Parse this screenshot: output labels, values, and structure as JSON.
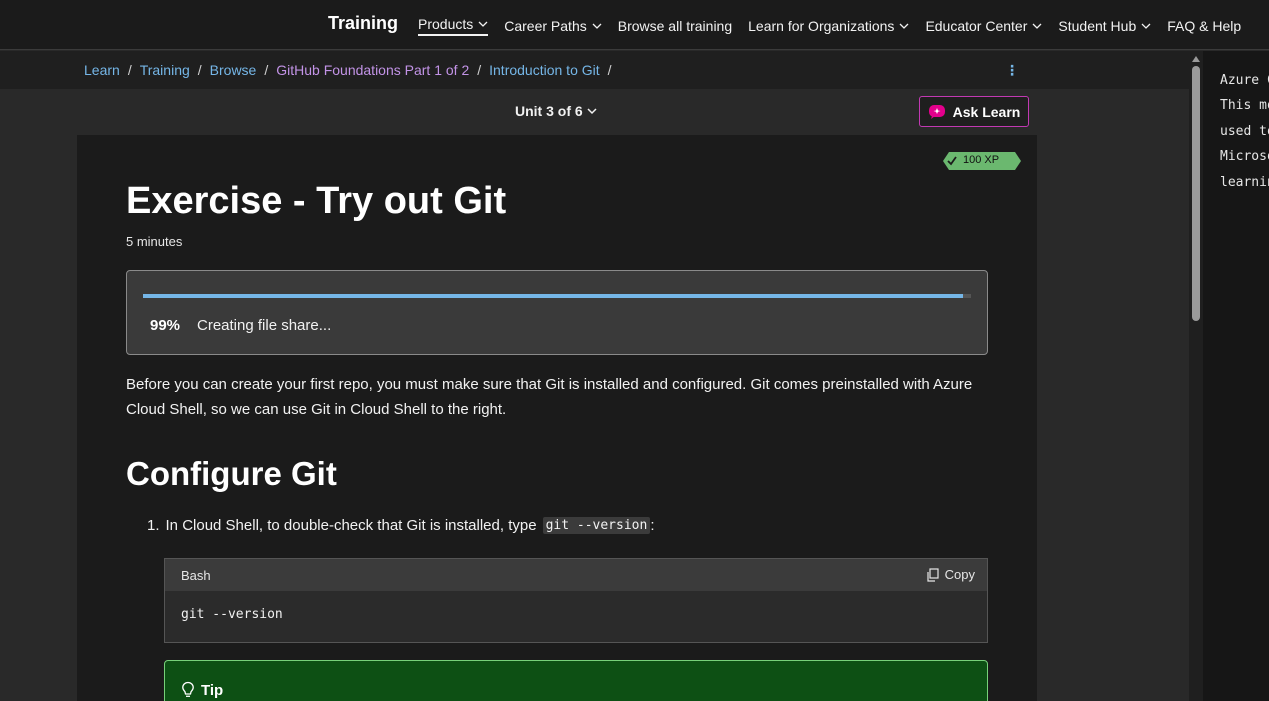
{
  "nav": {
    "brand": "Training",
    "items": [
      {
        "label": "Products",
        "dropdown": true,
        "active": true
      },
      {
        "label": "Career Paths",
        "dropdown": true
      },
      {
        "label": "Browse all training",
        "dropdown": false
      },
      {
        "label": "Learn for Organizations",
        "dropdown": true
      },
      {
        "label": "Educator Center",
        "dropdown": true
      },
      {
        "label": "Student Hub",
        "dropdown": true
      },
      {
        "label": "FAQ & Help",
        "dropdown": false
      }
    ]
  },
  "breadcrumb": [
    {
      "label": "Learn"
    },
    {
      "label": "Training"
    },
    {
      "label": "Browse"
    },
    {
      "label": "GitHub Foundations Part 1 of 2"
    },
    {
      "label": "Introduction to Git"
    }
  ],
  "unit": {
    "label": "Unit 3 of 6"
  },
  "ask_learn": {
    "label": "Ask Learn"
  },
  "xp": {
    "label": "100 XP"
  },
  "page": {
    "title": "Exercise - Try out Git",
    "duration": "5 minutes"
  },
  "progress": {
    "percent_label": "99%",
    "percent": 99,
    "status": "Creating file share..."
  },
  "intro": "Before you can create your first repo, you must make sure that Git is installed and configured. Git comes preinstalled with Azure Cloud Shell, so we can use Git in Cloud Shell to the right.",
  "section": {
    "heading": "Configure Git"
  },
  "step1": {
    "number": "1.",
    "text": "In Cloud Shell, to double-check that Git is installed, type",
    "code": "git --version",
    "suffix": ":"
  },
  "codeblock": {
    "language": "Bash",
    "copy_label": "Copy",
    "code": "git --version"
  },
  "tip": {
    "label": "Tip"
  },
  "shell": {
    "lines": [
      "Azure C",
      "This mo",
      "used to",
      "Microso",
      "learnin"
    ]
  },
  "colors": {
    "accent_link": "#75b6e7",
    "visited_link": "#c293e6",
    "tip_background": "#0d5014",
    "xp_badge": "#6bb86f",
    "ask_learn_border": "#c239b3"
  }
}
